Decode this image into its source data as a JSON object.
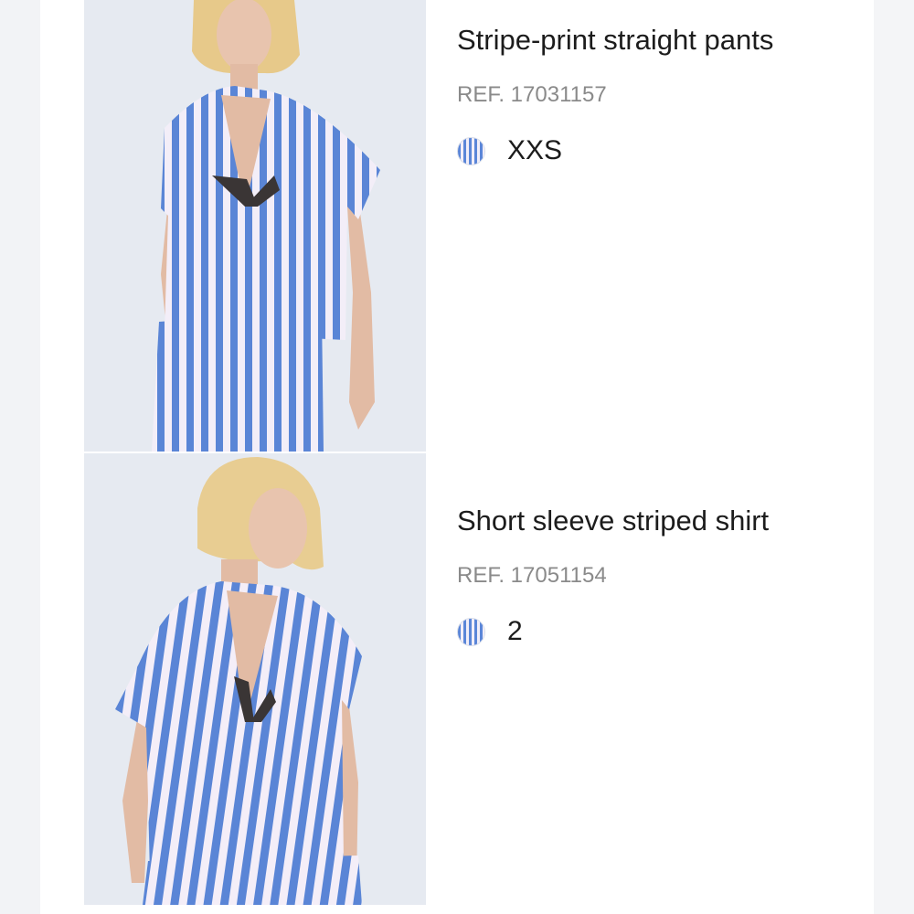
{
  "products": [
    {
      "title": "Stripe-print straight pants",
      "ref": "REF. 17031157",
      "size": "XXS"
    },
    {
      "title": "Short sleeve striped shirt",
      "ref": "REF. 17051154",
      "size": "2"
    }
  ],
  "icons": {
    "color_swatch": "striped-color-swatch-icon"
  },
  "colors": {
    "stripe_blue": "#5b86d8",
    "stripe_light": "#f2eef8",
    "ref_text": "#8a8a8a",
    "title_text": "#1c1c1c"
  }
}
